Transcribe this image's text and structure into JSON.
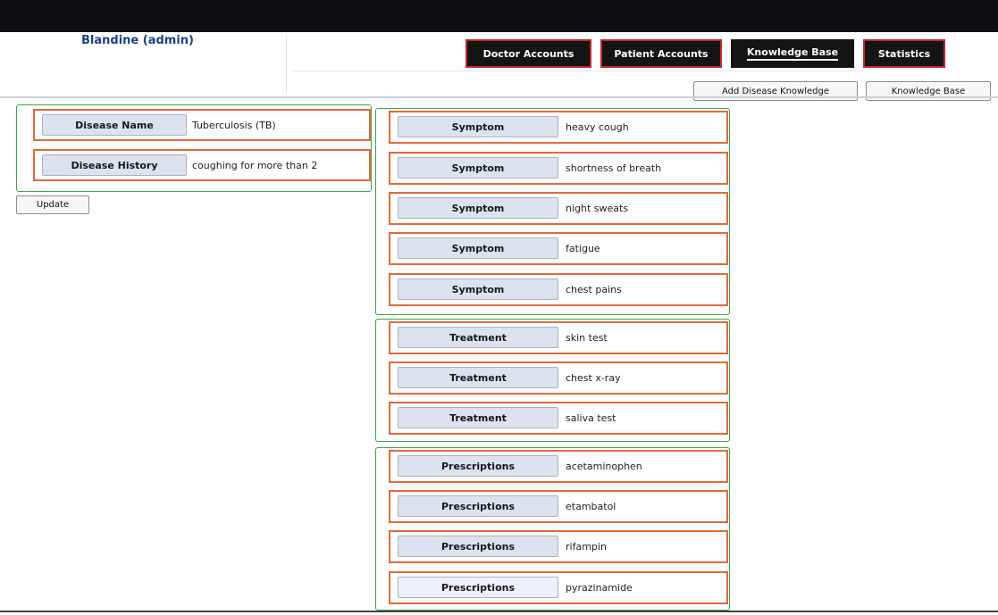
{
  "header": {
    "user": "Blandine (admin)",
    "nav_tabs": [
      {
        "label": "Doctor Accounts",
        "active": false
      },
      {
        "label": "Patient Accounts",
        "active": false
      },
      {
        "label": "Knowledge Base",
        "active": true
      },
      {
        "label": "Statistics",
        "active": false
      }
    ],
    "sub_buttons": [
      {
        "label": "Add Disease Knowledge"
      },
      {
        "label": "Knowledge Base"
      }
    ]
  },
  "disease": {
    "name_label": "Disease Name",
    "name_value": "Tuberculosis (TB)",
    "history_label": "Disease History",
    "history_value": "coughing for more than 2"
  },
  "update_label": "Update",
  "symptoms": [
    {
      "label": "Symptom",
      "value": "heavy cough"
    },
    {
      "label": "Symptom",
      "value": "shortness of breath"
    },
    {
      "label": "Symptom",
      "value": "night sweats"
    },
    {
      "label": "Symptom",
      "value": "fatigue"
    },
    {
      "label": "Symptom",
      "value": "chest pains"
    }
  ],
  "treatments": [
    {
      "label": "Treatment",
      "value": "skin test"
    },
    {
      "label": "Treatment",
      "value": "chest x-ray"
    },
    {
      "label": "Treatment",
      "value": "saliva test"
    }
  ],
  "prescriptions": [
    {
      "label": "Prescriptions",
      "value": "acetaminophen"
    },
    {
      "label": "Prescriptions",
      "value": "etambatol"
    },
    {
      "label": "Prescriptions",
      "value": "rifampin"
    },
    {
      "label": "Prescriptions",
      "value": "pyrazinamide"
    }
  ],
  "colors": {
    "topbar": "#0d0d12",
    "tab_border": "#c0282d",
    "group_border": "#3aa64a",
    "row_border": "#e26a3a",
    "user_text": "#1c3f8a"
  }
}
